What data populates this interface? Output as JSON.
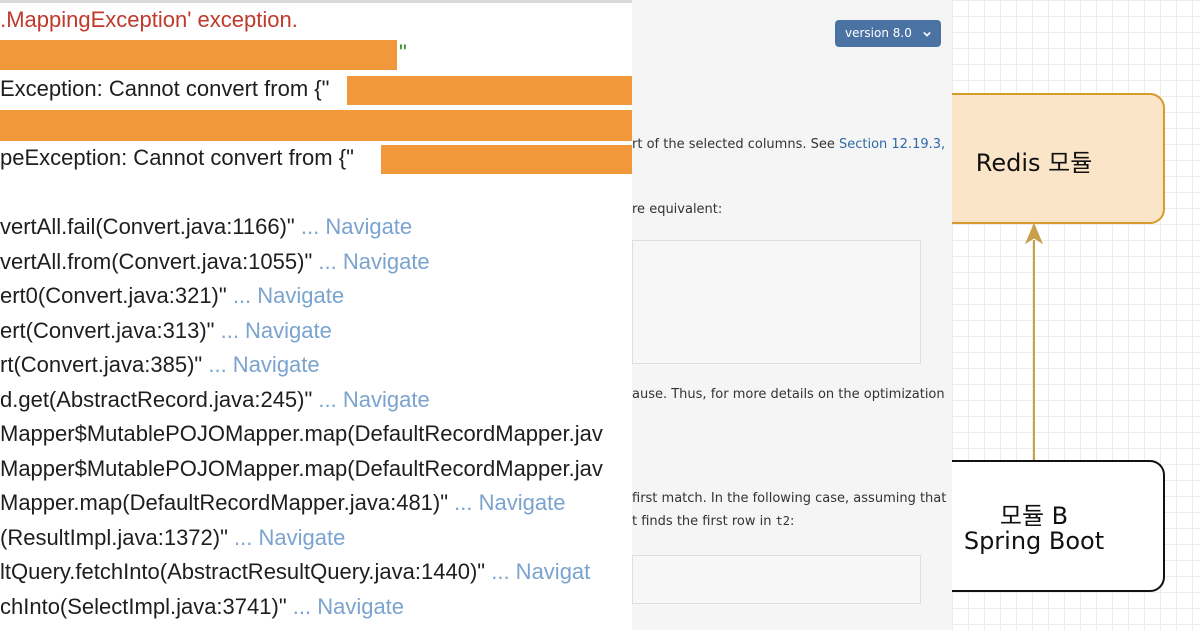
{
  "stack_trace": {
    "error_title": "..MappingException' exception.",
    "quote_mark": "\"",
    "lines": [
      {
        "text": "Exception: Cannot convert from {\"",
        "nav": ""
      },
      {
        "text": "peException: Cannot convert from {\"",
        "nav": ""
      },
      {
        "text": "vertAll.fail(Convert.java:1166)\"",
        "nav": "... Navigate"
      },
      {
        "text": "vertAll.from(Convert.java:1055)\"",
        "nav": "... Navigate"
      },
      {
        "text": "ert0(Convert.java:321)\"",
        "nav": "... Navigate"
      },
      {
        "text": "ert(Convert.java:313)\"",
        "nav": "... Navigate"
      },
      {
        "text": "rt(Convert.java:385)\"",
        "nav": "... Navigate"
      },
      {
        "text": "d.get(AbstractRecord.java:245)\"",
        "nav": "... Navigate"
      },
      {
        "text": "Mapper$MutablePOJOMapper.map(DefaultRecordMapper.jav",
        "nav": ""
      },
      {
        "text": "Mapper$MutablePOJOMapper.map(DefaultRecordMapper.jav",
        "nav": ""
      },
      {
        "text": "Mapper.map(DefaultRecordMapper.java:481)\"",
        "nav": "... Navigate"
      },
      {
        "text": "(ResultImpl.java:1372)\"",
        "nav": "... Navigate"
      },
      {
        "text": "ltQuery.fetchInto(AbstractResultQuery.java:1440)\"",
        "nav": "... Navigat"
      },
      {
        "text": "chInto(SelectImpl.java:3741)\"",
        "nav": "... Navigate"
      }
    ]
  },
  "docs": {
    "version_label": "version 8.0",
    "para1_prefix": "rt of the selected columns. See ",
    "para1_link": "Section 12.19.3,",
    "para2": "re equivalent:",
    "para3": "ause. Thus, for more details on the optimization",
    "para4": "first match. In the following case, assuming that",
    "para5_prefix": "t finds the first row in ",
    "para5_code": "t2",
    "para5_suffix": ":"
  },
  "diagram": {
    "top_node": "Redis 모듈",
    "bottom_node_line1": "모듈 B",
    "bottom_node_line2": "Spring Boot",
    "colors": {
      "top_fill": "#fbe5c8",
      "top_stroke": "#d89a2b",
      "arrow": "#c8a04a",
      "bottom_stroke": "#111111"
    }
  },
  "colors": {
    "redaction": "#f0983a",
    "error_text": "#c0392b",
    "navigate_link": "#7aa3cf",
    "version_button": "#4a72a3",
    "doc_link": "#2f6aa8"
  }
}
